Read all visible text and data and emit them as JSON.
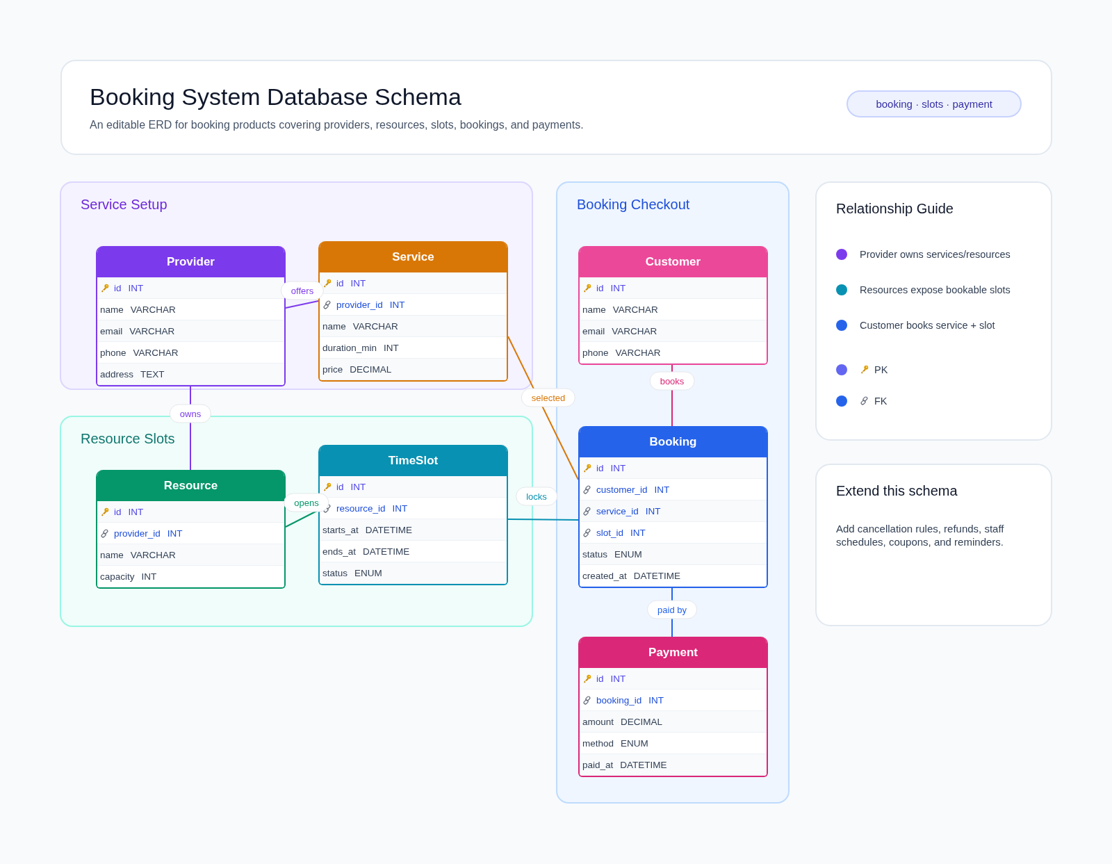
{
  "header": {
    "title": "Booking System Database Schema",
    "subtitle": "An editable ERD for booking products covering providers, resources, slots, bookings, and payments.",
    "tag": "booking · slots · payment"
  },
  "groups": [
    {
      "title": "Service Setup",
      "color": "#6d28d9"
    },
    {
      "title": "Resource Slots",
      "color": "#0f766e"
    },
    {
      "title": "Booking Checkout",
      "color": "#1d4ed8"
    }
  ],
  "entities": [
    {
      "name": "Provider",
      "color": "#7c3aed",
      "columns": [
        {
          "name": "id",
          "type": "INT",
          "kind": "pk"
        },
        {
          "name": "name",
          "type": "VARCHAR",
          "kind": "plain"
        },
        {
          "name": "email",
          "type": "VARCHAR",
          "kind": "plain"
        },
        {
          "name": "phone",
          "type": "VARCHAR",
          "kind": "plain"
        },
        {
          "name": "address",
          "type": "TEXT",
          "kind": "plain"
        }
      ]
    },
    {
      "name": "Service",
      "color": "#d97706",
      "columns": [
        {
          "name": "id",
          "type": "INT",
          "kind": "pk"
        },
        {
          "name": "provider_id",
          "type": "INT",
          "kind": "fk"
        },
        {
          "name": "name",
          "type": "VARCHAR",
          "kind": "plain"
        },
        {
          "name": "duration_min",
          "type": "INT",
          "kind": "plain"
        },
        {
          "name": "price",
          "type": "DECIMAL",
          "kind": "plain"
        }
      ]
    },
    {
      "name": "Resource",
      "color": "#059669",
      "columns": [
        {
          "name": "id",
          "type": "INT",
          "kind": "pk"
        },
        {
          "name": "provider_id",
          "type": "INT",
          "kind": "fk"
        },
        {
          "name": "name",
          "type": "VARCHAR",
          "kind": "plain"
        },
        {
          "name": "capacity",
          "type": "INT",
          "kind": "plain"
        }
      ]
    },
    {
      "name": "TimeSlot",
      "color": "#0891b2",
      "columns": [
        {
          "name": "id",
          "type": "INT",
          "kind": "pk"
        },
        {
          "name": "resource_id",
          "type": "INT",
          "kind": "fk"
        },
        {
          "name": "starts_at",
          "type": "DATETIME",
          "kind": "plain"
        },
        {
          "name": "ends_at",
          "type": "DATETIME",
          "kind": "plain"
        },
        {
          "name": "status",
          "type": "ENUM",
          "kind": "plain"
        }
      ]
    },
    {
      "name": "Customer",
      "color": "#ec4899",
      "columns": [
        {
          "name": "id",
          "type": "INT",
          "kind": "pk"
        },
        {
          "name": "name",
          "type": "VARCHAR",
          "kind": "plain"
        },
        {
          "name": "email",
          "type": "VARCHAR",
          "kind": "plain"
        },
        {
          "name": "phone",
          "type": "VARCHAR",
          "kind": "plain"
        }
      ]
    },
    {
      "name": "Booking",
      "color": "#2563eb",
      "columns": [
        {
          "name": "id",
          "type": "INT",
          "kind": "pk"
        },
        {
          "name": "customer_id",
          "type": "INT",
          "kind": "fk"
        },
        {
          "name": "service_id",
          "type": "INT",
          "kind": "fk"
        },
        {
          "name": "slot_id",
          "type": "INT",
          "kind": "fk"
        },
        {
          "name": "status",
          "type": "ENUM",
          "kind": "plain"
        },
        {
          "name": "created_at",
          "type": "DATETIME",
          "kind": "plain"
        }
      ]
    },
    {
      "name": "Payment",
      "color": "#db2777",
      "columns": [
        {
          "name": "id",
          "type": "INT",
          "kind": "pk"
        },
        {
          "name": "booking_id",
          "type": "INT",
          "kind": "fk"
        },
        {
          "name": "amount",
          "type": "DECIMAL",
          "kind": "plain"
        },
        {
          "name": "method",
          "type": "ENUM",
          "kind": "plain"
        },
        {
          "name": "paid_at",
          "type": "DATETIME",
          "kind": "plain"
        }
      ]
    }
  ],
  "relationships": [
    {
      "label": "offers",
      "color": "#7c3aed"
    },
    {
      "label": "owns",
      "color": "#7c3aed"
    },
    {
      "label": "opens",
      "color": "#059669"
    },
    {
      "label": "selected",
      "color": "#d97706"
    },
    {
      "label": "locks",
      "color": "#0891b2"
    },
    {
      "label": "books",
      "color": "#db2777"
    },
    {
      "label": "paid by",
      "color": "#2563eb"
    }
  ],
  "guide": {
    "title": "Relationship Guide",
    "items": [
      {
        "text": "Provider owns services/resources",
        "color": "#7c3aed",
        "kind": "relation"
      },
      {
        "text": "Resources expose bookable slots",
        "color": "#0891b2",
        "kind": "relation"
      },
      {
        "text": "Customer books service + slot",
        "color": "#2563eb",
        "kind": "relation"
      },
      {
        "text": "PK",
        "color": "#6366f1",
        "kind": "pk"
      },
      {
        "text": "FK",
        "color": "#2563eb",
        "kind": "fk"
      }
    ]
  },
  "extend": {
    "title": "Extend this schema",
    "text": "Add cancellation rules, refunds, staff schedules, coupons, and reminders."
  }
}
